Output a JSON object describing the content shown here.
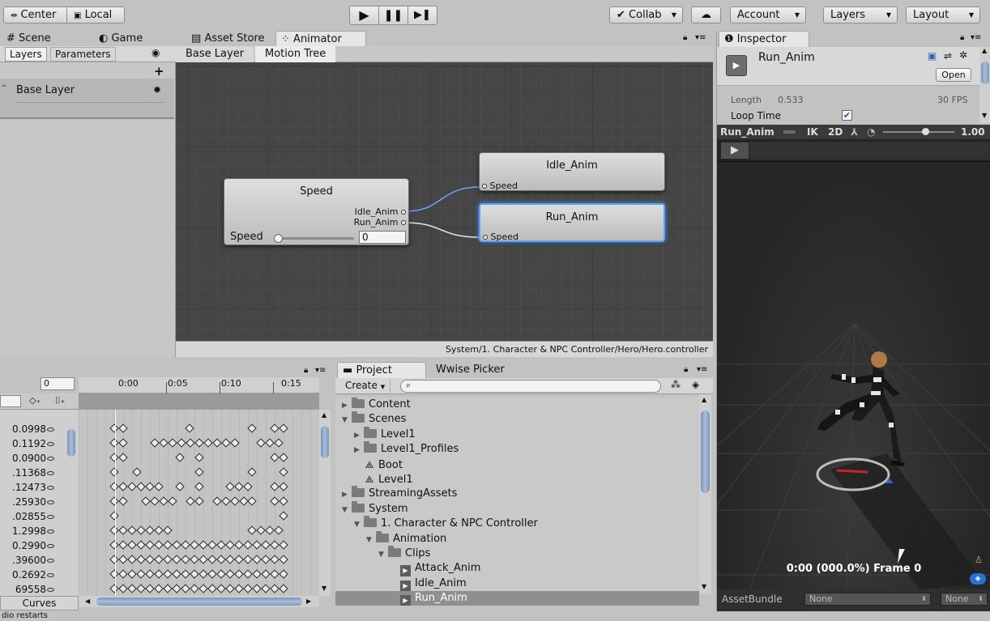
{
  "toolbar": {
    "center_label": "Center",
    "local_label": "Local",
    "collab_label": "Collab",
    "account_label": "Account",
    "layers_label": "Layers",
    "layout_label": "Layout"
  },
  "tabs": {
    "scene": "Scene",
    "game": "Game",
    "asset_store": "Asset Store",
    "animator": "Animator",
    "inspector": "Inspector"
  },
  "animator": {
    "subtabs": [
      "Layers",
      "Parameters"
    ],
    "layer_name": "Base Layer",
    "breadcrumb": [
      "Base Layer",
      "Motion Tree"
    ],
    "path": "System/1. Character & NPC Controller/Hero/Hero.controller",
    "blend_node": {
      "title": "Speed",
      "outputs": [
        "Idle_Anim",
        "Run_Anim"
      ],
      "param_label": "Speed",
      "param_value": "0",
      "slider_fraction": 0.0
    },
    "motion_nodes": [
      {
        "title": "Idle_Anim",
        "input": "Speed",
        "selected": false
      },
      {
        "title": "Run_Anim",
        "input": "Speed",
        "selected": true
      }
    ]
  },
  "inspector": {
    "asset_name": "Run_Anim",
    "open_label": "Open",
    "length_label": "Length",
    "length_value": "0.533",
    "fps": "30 FPS",
    "loop_time_label": "Loop Time",
    "loop_time_checked": true,
    "preview_clip": "Run_Anim",
    "ik_label": "IK",
    "two_d_label": "2D",
    "speed_value": "1.00",
    "speed_fraction": 0.6,
    "frame_readout": "0:00 (000.0%) Frame 0",
    "assetbundle_label": "AssetBundle",
    "assetbundle_value": "None",
    "variant_value": "None"
  },
  "dopesheet": {
    "frame_field": "0",
    "time_ticks": [
      "0:00",
      "0:05",
      "0:10",
      "0:15"
    ],
    "values": [
      "0.0998",
      "0.1192",
      "0.0900",
      ".11368",
      ".12473",
      ".25930",
      ".02855",
      "1.2998",
      "0.2990",
      ".39600",
      "0.2692",
      "69558"
    ],
    "curves_label": "Curves"
  },
  "project": {
    "tab_project": "Project",
    "tab_wwise": "Wwise Picker",
    "create_label": "Create",
    "search_placeholder": "",
    "items": [
      {
        "label": "Content",
        "depth": 0,
        "kind": "folder",
        "open": false,
        "expander": true
      },
      {
        "label": "Scenes",
        "depth": 0,
        "kind": "folder",
        "open": true,
        "expander": true
      },
      {
        "label": "Level1",
        "depth": 1,
        "kind": "folder",
        "open": false,
        "expander": true
      },
      {
        "label": "Level1_Profiles",
        "depth": 1,
        "kind": "folder",
        "open": false,
        "expander": true
      },
      {
        "label": "Boot",
        "depth": 1,
        "kind": "scene",
        "open": false,
        "expander": false
      },
      {
        "label": "Level1",
        "depth": 1,
        "kind": "scene",
        "open": false,
        "expander": false
      },
      {
        "label": "StreamingAssets",
        "depth": 0,
        "kind": "folder",
        "open": false,
        "expander": true
      },
      {
        "label": "System",
        "depth": 0,
        "kind": "folder",
        "open": true,
        "expander": true
      },
      {
        "label": "1. Character & NPC Controller",
        "depth": 1,
        "kind": "folder",
        "open": true,
        "expander": true
      },
      {
        "label": "Animation",
        "depth": 2,
        "kind": "folder",
        "open": true,
        "expander": true
      },
      {
        "label": "Clips",
        "depth": 3,
        "kind": "folder",
        "open": true,
        "expander": true
      },
      {
        "label": "Attack_Anim",
        "depth": 4,
        "kind": "clip",
        "open": false,
        "expander": false
      },
      {
        "label": "Idle_Anim",
        "depth": 4,
        "kind": "clip",
        "open": false,
        "expander": false
      },
      {
        "label": "Run_Anim",
        "depth": 4,
        "kind": "clip",
        "open": false,
        "expander": false,
        "selected": true
      }
    ]
  },
  "status_bar": "dio restarts",
  "colors": {
    "accent_blue": "#4a78c8",
    "selection_gray": "#8f8f8f",
    "preview_bg": "#2b2b2b"
  }
}
